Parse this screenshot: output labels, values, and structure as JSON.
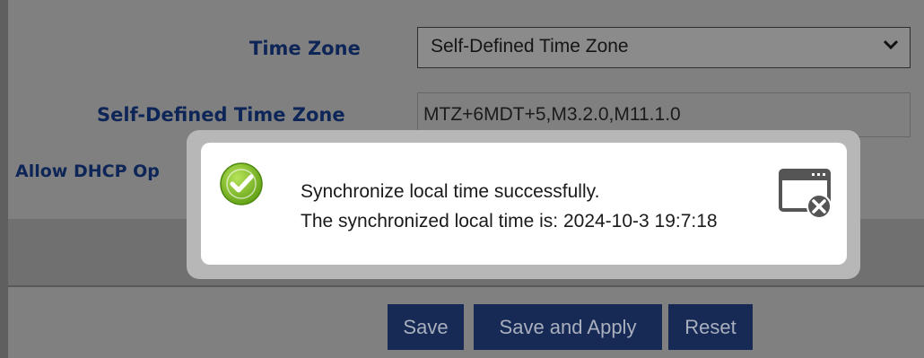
{
  "form": {
    "time_zone_label": "Time Zone",
    "time_zone_value": "Self-Defined Time Zone",
    "self_defined_label": "Self-Defined Time Zone",
    "self_defined_value": "MTZ+6MDT+5,M3.2.0,M11.1.0",
    "dhcp_label": "Allow DHCP Op"
  },
  "buttons": {
    "save": "Save",
    "save_apply": "Save and Apply",
    "reset": "Reset"
  },
  "modal": {
    "line1": "Synchronize local time successfully.",
    "line2": "The synchronized local time is: 2024-10-3 19:7:18",
    "icons": [
      "check-circle-icon",
      "close-window-icon"
    ]
  },
  "colors": {
    "overlay": "#808080",
    "button_bg": "#162a55",
    "label_color": "#0d2557",
    "success_green": "#7cbc1e"
  }
}
